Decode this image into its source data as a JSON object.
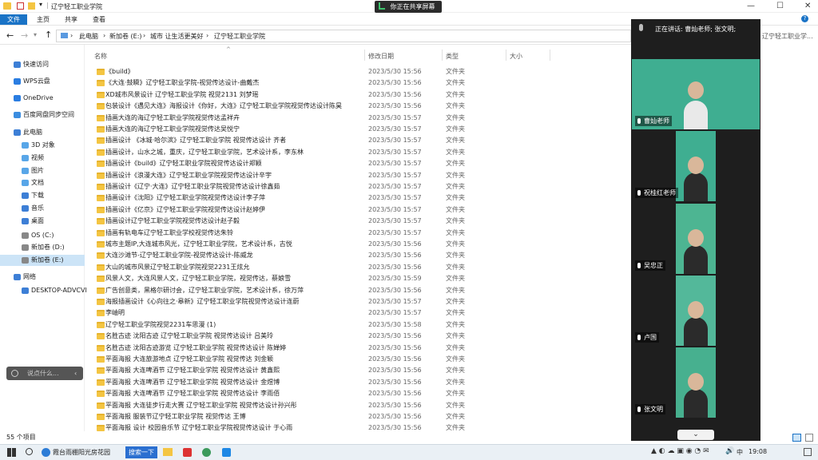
{
  "window": {
    "title": "辽宁轻工职业学院"
  },
  "share_badge": "你正在共享屏幕",
  "ribbon": {
    "tabs": [
      "文件",
      "主页",
      "共享",
      "查看"
    ]
  },
  "address": {
    "crumbs": [
      "此电脑",
      "新加卷 (E:)",
      "城市 让生活更美好",
      "辽宁轻工职业学院"
    ]
  },
  "nav": [
    {
      "label": "快速访问",
      "color": "#3d7fd6"
    },
    {
      "label": "WPS云盘",
      "color": "#2a7de1"
    },
    {
      "label": "OneDrive",
      "color": "#2a7de1"
    },
    {
      "label": "百度网盘同步空间",
      "color": "#3b8de0"
    },
    {
      "label": "此电脑",
      "color": "#3d7fd6"
    },
    {
      "label": "3D 对象",
      "color": "#58a6e8"
    },
    {
      "label": "视频",
      "color": "#58a6e8"
    },
    {
      "label": "图片",
      "color": "#58a6e8"
    },
    {
      "label": "文档",
      "color": "#58a6e8"
    },
    {
      "label": "下载",
      "color": "#3d7fd6"
    },
    {
      "label": "音乐",
      "color": "#3d7fd6"
    },
    {
      "label": "桌面",
      "color": "#3d7fd6"
    },
    {
      "label": "OS (C:)",
      "color": "#888888"
    },
    {
      "label": "新加卷 (D:)",
      "color": "#888888"
    },
    {
      "label": "新加卷 (E:)",
      "color": "#888888"
    },
    {
      "label": "网络",
      "color": "#3d7fd6"
    },
    {
      "label": "DESKTOP-ADVCVI",
      "color": "#3d7fd6"
    }
  ],
  "columns": {
    "name": "名称",
    "date": "修改日期",
    "type": "类型",
    "size": "大小"
  },
  "files": [
    {
      "name": "《build》",
      "date": "2023/5/30 15:56",
      "type": "文件夹"
    },
    {
      "name": "《大连·鼓瞬》辽宁轻工职业学院-视觉传达设计-曲戴杰",
      "date": "2023/5/30 15:56",
      "type": "文件夹"
    },
    {
      "name": "XD城市风景设计 辽宁轻工职业学院 视觉2131 刘梦瑶",
      "date": "2023/5/30 15:56",
      "type": "文件夹"
    },
    {
      "name": "包装设计《遇见大连》海报设计《你好，大连》辽宁轻工职业学院视觉传达设计陈昊",
      "date": "2023/5/30 15:56",
      "type": "文件夹"
    },
    {
      "name": "插画大连的海辽宁轻工职业学院视觉传达孟祥卉",
      "date": "2023/5/30 15:57",
      "type": "文件夹"
    },
    {
      "name": "插画大连的海辽宁轻工职业学院视觉传达吴悦宁",
      "date": "2023/5/30 15:57",
      "type": "文件夹"
    },
    {
      "name": "插画设计 《冰城·哈尔滨》辽宁轻工职业学院 视觉传达设计 齐者",
      "date": "2023/5/30 15:57",
      "type": "文件夹"
    },
    {
      "name": "插画设计，山水之城，重庆，辽宁轻工职业学院，艺术设计系，李东林",
      "date": "2023/5/30 15:57",
      "type": "文件夹"
    },
    {
      "name": "插画设计《build》辽宁轻工职业学院视觉传达设计郑颖",
      "date": "2023/5/30 15:57",
      "type": "文件夹"
    },
    {
      "name": "插画设计《浪漫大连》辽宁轻工职业学院视觉传达设计辛宇",
      "date": "2023/5/30 15:57",
      "type": "文件夹"
    },
    {
      "name": "插画设计《辽宁·大连》辽宁轻工职业学院视觉传达设计徐鑫茹",
      "date": "2023/5/30 15:57",
      "type": "文件夹"
    },
    {
      "name": "插画设计《沈阳》辽宁轻工职业学院视觉传达设计李子萍",
      "date": "2023/5/30 15:57",
      "type": "文件夹"
    },
    {
      "name": "插画设计《亿京》辽宁轻工职业学院视觉传达设计赵婷伊",
      "date": "2023/5/30 15:57",
      "type": "文件夹"
    },
    {
      "name": "插画设计辽宁轻工职业学院视觉传达设计赵子毅",
      "date": "2023/5/30 15:57",
      "type": "文件夹"
    },
    {
      "name": "插画有轨电车辽宁轻工职业学校视觉传达朱铃",
      "date": "2023/5/30 15:57",
      "type": "文件夹"
    },
    {
      "name": "城市主题IP,大连城市风光，辽宁轻工职业学院，艺术设计系，古悦",
      "date": "2023/5/30 15:56",
      "type": "文件夹"
    },
    {
      "name": "大连沙滩节-辽宁轻工职业学院-视觉传达设计-陈威龙",
      "date": "2023/5/30 15:56",
      "type": "文件夹"
    },
    {
      "name": "大山的城市风景辽宁轻工职业学院视觉2231王炫允",
      "date": "2023/5/30 15:56",
      "type": "文件夹"
    },
    {
      "name": "风景人文，大连风景人文，辽宁轻工职业学院，视觉传达，蔡娘雪",
      "date": "2023/5/30 15:59",
      "type": "文件夹"
    },
    {
      "name": "广告创意类，黑格尔研讨会，辽宁轻工职业学院，艺术设计系，徐万萍",
      "date": "2023/5/30 15:56",
      "type": "文件夹"
    },
    {
      "name": "海报插画设计《心向往之·皋新》辽宁轻工职业学院视觉传达设计连蔚",
      "date": "2023/5/30 15:57",
      "type": "文件夹"
    },
    {
      "name": "李岫明",
      "date": "2023/5/30 15:57",
      "type": "文件夹"
    },
    {
      "name": "辽宁轻工职业学院视觉2231车思漫 (1)",
      "date": "2023/5/30 15:58",
      "type": "文件夹"
    },
    {
      "name": "名胜古迹 沈阳古迹 辽宁轻工职业学院 视觉传达设计 吕美玲",
      "date": "2023/5/30 15:56",
      "type": "文件夹"
    },
    {
      "name": "名胜古迹 沈阳古迹游览 辽宁轻工职业学院 视觉传达设计 陈婵婷",
      "date": "2023/5/30 15:56",
      "type": "文件夹"
    },
    {
      "name": "平面海报 大连旅游地点 辽宁轻工职业学院 视觉传达 刘金颖",
      "date": "2023/5/30 15:56",
      "type": "文件夹"
    },
    {
      "name": "平面海报 大连啤酒节 辽宁轻工职业学院 视觉传达设计 黄鑫熙",
      "date": "2023/5/30 15:56",
      "type": "文件夹"
    },
    {
      "name": "平面海报 大连啤酒节 辽宁轻工职业学院 视觉传达设计 金煜博",
      "date": "2023/5/30 15:56",
      "type": "文件夹"
    },
    {
      "name": "平面海报 大连啤酒节 辽宁轻工职业学院 视觉传达设计 李雨佰",
      "date": "2023/5/30 15:56",
      "type": "文件夹"
    },
    {
      "name": "平面海报 大连徒步行走大赛 辽宁轻工职业学院 视觉传达设计孙兴彤",
      "date": "2023/5/30 15:56",
      "type": "文件夹"
    },
    {
      "name": "平面海报 服装节辽宁轻工职业学院 视觉传达 王博",
      "date": "2023/5/30 15:56",
      "type": "文件夹"
    },
    {
      "name": "平面海报 设计 校园音乐节 辽宁轻工职业学院视觉传达设计 于心雨",
      "date": "2023/5/30 15:56",
      "type": "文件夹"
    }
  ],
  "status": {
    "count": "55 个项目"
  },
  "pill": {
    "placeholder": "说点什么..."
  },
  "meeting": {
    "speaking": "正在讲话: 曹灿老师; 张文明;",
    "address_overflow": "辽宁轻工职业学...",
    "participants": [
      {
        "name": "曹灿老师",
        "bg": "#3fae91"
      },
      {
        "name": "祝桂红老师",
        "bg": "#3fae91"
      },
      {
        "name": "吴忠正",
        "bg": "#4db592"
      },
      {
        "name": "卢国",
        "bg": "#53b89a"
      },
      {
        "name": "张文明",
        "bg": "#47b08f"
      }
    ]
  },
  "taskbar": {
    "search": "搜索一下",
    "browser": "霞台雨棚阳光房花园",
    "time": "19:08",
    "lang": "中"
  },
  "colors": {
    "accent": "#1a73c6",
    "folder": "#f4c542",
    "meeting_bg": "#1e1e1e"
  }
}
